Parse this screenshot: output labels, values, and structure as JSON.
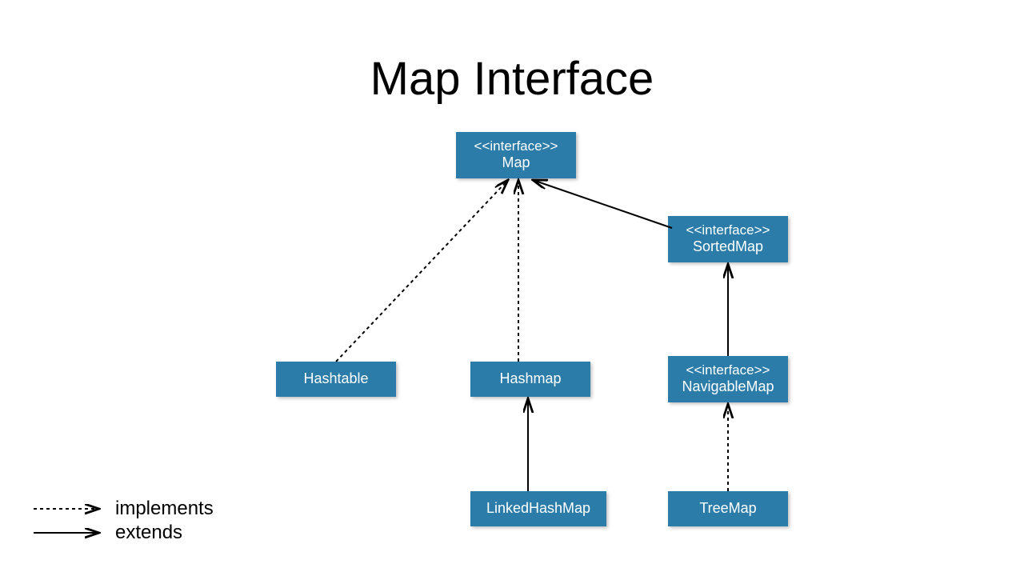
{
  "title": "Map Interface",
  "nodes": {
    "map": {
      "stereotype": "<<interface>>",
      "name": "Map"
    },
    "sortedmap": {
      "stereotype": "<<interface>>",
      "name": "SortedMap"
    },
    "navigablemap": {
      "stereotype": "<<interface>>",
      "name": "NavigableMap"
    },
    "hashtable": {
      "name": "Hashtable"
    },
    "hashmap": {
      "name": "Hashmap"
    },
    "linkedhashmap": {
      "name": "LinkedHashMap"
    },
    "treemap": {
      "name": "TreeMap"
    }
  },
  "legend": {
    "implements": "implements",
    "extends": "extends"
  },
  "edges": [
    {
      "from": "hashtable",
      "to": "map",
      "kind": "implements"
    },
    {
      "from": "hashmap",
      "to": "map",
      "kind": "implements"
    },
    {
      "from": "sortedmap",
      "to": "map",
      "kind": "extends"
    },
    {
      "from": "navigablemap",
      "to": "sortedmap",
      "kind": "extends"
    },
    {
      "from": "treemap",
      "to": "navigablemap",
      "kind": "implements"
    },
    {
      "from": "linkedhashmap",
      "to": "hashmap",
      "kind": "extends"
    }
  ]
}
